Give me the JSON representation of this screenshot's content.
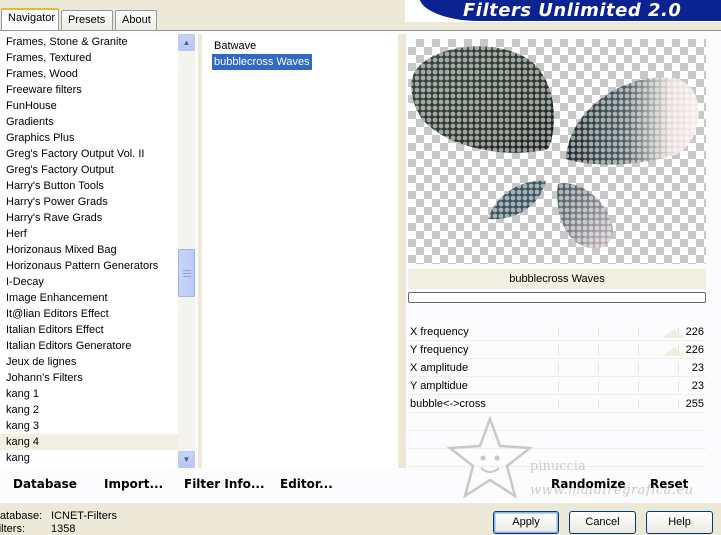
{
  "tabs": [
    {
      "label": "Navigator",
      "active": true
    },
    {
      "label": "Presets",
      "active": false
    },
    {
      "label": "About",
      "active": false
    }
  ],
  "banner": {
    "title": "Filters Unlimited 2.0",
    "color": "#0a2391"
  },
  "categories": {
    "items": [
      "Frames, Stone & Granite",
      "Frames, Textured",
      "Frames, Wood",
      "Freeware filters",
      "FunHouse",
      "Gradients",
      "Graphics Plus",
      "Greg's Factory Output Vol. II",
      "Greg's Factory Output",
      "Harry's Button Tools",
      "Harry's Power Grads",
      "Harry's Rave Grads",
      "Herf",
      "Horizonaus Mixed Bag",
      "Horizonaus Pattern Generators",
      "I-Decay",
      "Image Enhancement",
      "It@lian Editors Effect",
      "Italian Editors Effect",
      "Italian Editors Generatore",
      "Jeux de lignes",
      "Johann's Filters",
      "kang 1",
      "kang 2",
      "kang 3",
      "kang 4",
      "kang"
    ],
    "selected": "kang 4"
  },
  "filters": {
    "items": [
      "Batwave",
      "bubblecross Waves"
    ],
    "selected": "bubblecross Waves"
  },
  "preview": {
    "filter_name": "bubblecross Waves"
  },
  "params": [
    {
      "label": "X frequency",
      "value": "226"
    },
    {
      "label": "Y frequency",
      "value": "226"
    },
    {
      "label": "X amplitude",
      "value": "23"
    },
    {
      "label": "Y ampltidue",
      "value": "23"
    },
    {
      "label": "bubble<->cross",
      "value": "255"
    }
  ],
  "bottom_links": {
    "database": "Database",
    "import": "Import...",
    "filter_info": "Filter Info...",
    "editor": "Editor...",
    "randomize": "Randomize",
    "reset": "Reset"
  },
  "watermark": {
    "name": "pinuccia",
    "url": "www.maidiregrafica.eu"
  },
  "footer": {
    "database_key": "Database:",
    "database_val": "ICNET-Filters",
    "filters_key": "Filters:",
    "filters_val": "1358"
  },
  "buttons": {
    "apply": "Apply",
    "cancel": "Cancel",
    "help": "Help"
  }
}
